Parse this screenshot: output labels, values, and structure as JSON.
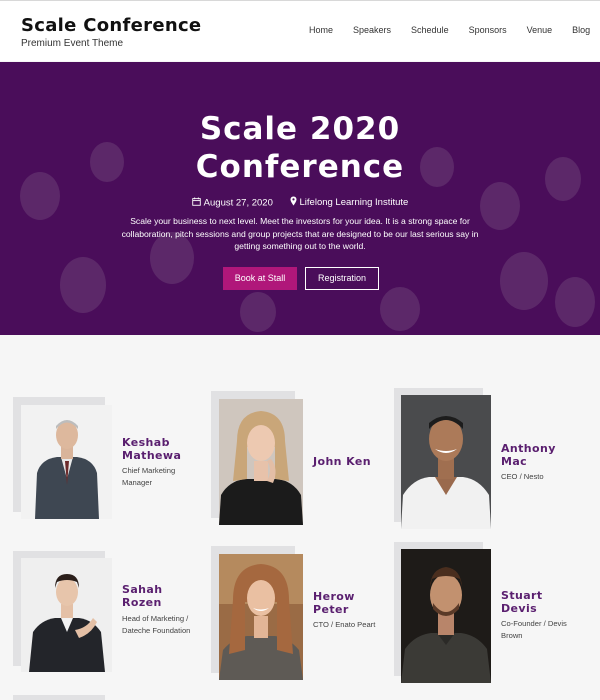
{
  "header": {
    "title": "Scale Conference",
    "subtitle": "Premium Event Theme",
    "nav": [
      "Home",
      "Speakers",
      "Schedule",
      "Sponsors",
      "Venue",
      "Blog"
    ]
  },
  "hero": {
    "title_line1": "Scale 2020",
    "title_line2": "Conference",
    "date": "August 27, 2020",
    "location": "Lifelong Learning Institute",
    "description": "Scale your business to next level. Meet the investors for your idea. It is a strong space for collaboration, pitch sessions and group projects that are designed to be our last serious say in getting something out to the world.",
    "cta_primary": "Book at Stall",
    "cta_secondary": "Registration"
  },
  "speakers": [
    {
      "name": "Keshab Mathewa",
      "role": "Chief Marketing Manager"
    },
    {
      "name": "John Ken",
      "role": ""
    },
    {
      "name": "Anthony Mac",
      "role": "CEO / Nesto"
    },
    {
      "name": "Sahah Rozen",
      "role": "Head of Marketing / Dateche Foundation"
    },
    {
      "name": "Herow Peter",
      "role": "CTO / Enato Peart"
    },
    {
      "name": "Stuart Devis",
      "role": "Co-Founder / Devis Brown"
    }
  ],
  "colors": {
    "hero_bg": "#4a0d5a",
    "accent": "#b0177a",
    "speaker_name": "#5a1f6f"
  }
}
